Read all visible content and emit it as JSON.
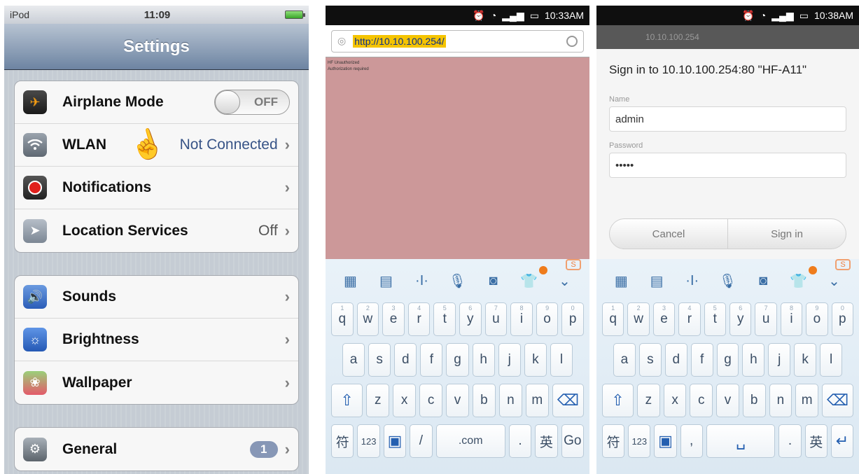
{
  "ios": {
    "status": {
      "carrier": "iPod",
      "time": "11:09"
    },
    "nav_title": "Settings",
    "groups": [
      [
        {
          "label": "Airplane Mode",
          "toggle": "OFF",
          "icon": "airplane-icon"
        },
        {
          "label": "WLAN",
          "value": "Not Connected",
          "icon": "wifi-icon"
        },
        {
          "label": "Notifications",
          "icon": "notifications-icon"
        },
        {
          "label": "Location Services",
          "value": "Off",
          "icon": "location-icon"
        }
      ],
      [
        {
          "label": "Sounds",
          "icon": "speaker-icon"
        },
        {
          "label": "Brightness",
          "icon": "sun-icon"
        },
        {
          "label": "Wallpaper",
          "icon": "wallpaper-icon"
        }
      ],
      [
        {
          "label": "General",
          "badge": "1",
          "icon": "gear-icon"
        }
      ]
    ]
  },
  "browser": {
    "status_time": "10:33AM",
    "url": "http://10.10.100.254/",
    "body_line1": "HF Unauthorized",
    "body_line2": "Authorization required"
  },
  "signin": {
    "status_time": "10:38AM",
    "bg_tab": "10.10.100.254",
    "title": "Sign in to 10.10.100.254:80 \"HF-A11\"",
    "name_label": "Name",
    "name_value": "admin",
    "password_label": "Password",
    "password_value": "•••••",
    "cancel": "Cancel",
    "sign_in": "Sign in"
  },
  "keyboard": {
    "row1": [
      "q",
      "w",
      "e",
      "r",
      "t",
      "y",
      "u",
      "i",
      "o",
      "p"
    ],
    "row1_hints": [
      "1",
      "2",
      "3",
      "4",
      "5",
      "6",
      "7",
      "8",
      "9",
      "0"
    ],
    "row2": [
      "a",
      "s",
      "d",
      "f",
      "g",
      "h",
      "j",
      "k",
      "l"
    ],
    "row3": [
      "z",
      "x",
      "c",
      "v",
      "b",
      "n",
      "m"
    ],
    "symbol_key": "符",
    "num_key": "123",
    "slash_key": "/",
    "com_key": ".com",
    "dot_key": ".",
    "comma_key": ",",
    "lang_key": "英",
    "go_key": "Go"
  },
  "colors": {
    "browser_page_bg": "#cc9899",
    "url_highlight": "#f5c400",
    "ios_link": "#385487"
  }
}
